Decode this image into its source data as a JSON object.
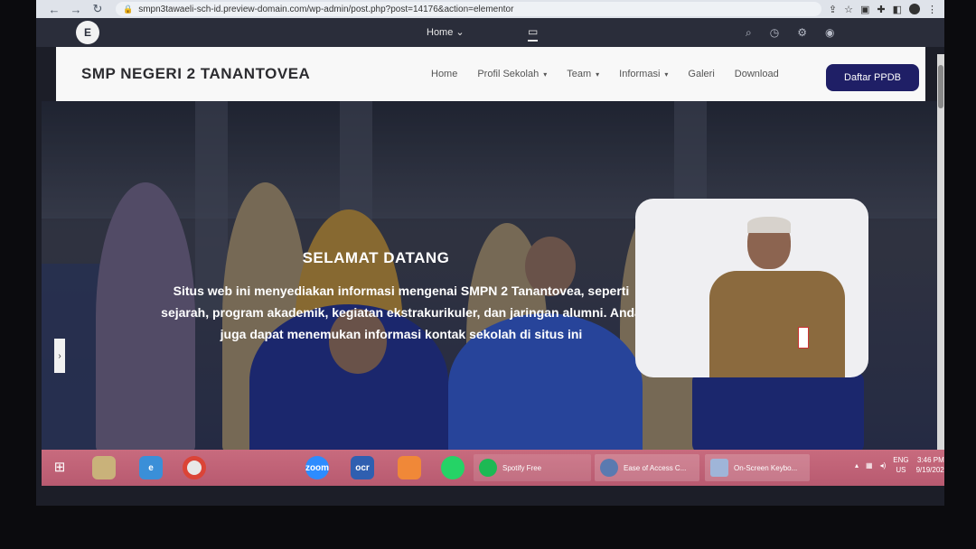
{
  "browser": {
    "url": "smpn3tawaeli-sch-id.preview-domain.com/wp-admin/post.php?post=14176&action=elementor",
    "nav": {
      "back": "←",
      "forward": "→",
      "reload": "↻"
    },
    "toolbar_icons": [
      "share-icon",
      "star-icon",
      "extension-icon",
      "puzzle-icon",
      "sidebar-icon",
      "profile-icon",
      "menu-icon"
    ]
  },
  "editor": {
    "logo": "E",
    "page_selector": "Home",
    "device_icon": "desktop-icon",
    "tool_icons": [
      "search-icon",
      "history-icon",
      "notifications-icon",
      "preview-icon"
    ]
  },
  "site": {
    "title": "SMP NEGERI 2 TANANTOVEA",
    "nav": [
      {
        "label": "Home",
        "dropdown": false
      },
      {
        "label": "Profil Sekolah",
        "dropdown": true
      },
      {
        "label": "Team",
        "dropdown": true
      },
      {
        "label": "Informasi",
        "dropdown": true
      },
      {
        "label": "Galeri",
        "dropdown": false
      },
      {
        "label": "Download",
        "dropdown": false
      }
    ],
    "cta": "Daftar PPDB"
  },
  "hero": {
    "heading": "SELAMAT DATANG",
    "text": "Situs web ini menyediakan informasi mengenai SMPN 2 Tanantovea, seperti sejarah, program akademik, kegiatan ekstrakurikuler, dan jaringan alumni. Anda juga dapat menemukan informasi kontak sekolah di situs ini",
    "side_toggle": "›"
  },
  "taskbar": {
    "start": "⊞",
    "apps": [
      {
        "name": "file-explorer",
        "label": ""
      },
      {
        "name": "internet-explorer",
        "label": ""
      },
      {
        "name": "chrome",
        "label": ""
      },
      {
        "name": "zoom",
        "label": "zoom"
      },
      {
        "name": "ocr",
        "label": "ocr"
      },
      {
        "name": "xampp",
        "label": ""
      },
      {
        "name": "whatsapp",
        "label": ""
      },
      {
        "name": "spotify",
        "label": "Spotify Free"
      }
    ],
    "windows": [
      {
        "label": "Ease of Access C..."
      },
      {
        "label": "On-Screen Keybo..."
      }
    ],
    "tray": {
      "lang": "ENG",
      "region": "US",
      "time": "3:46 PM",
      "date": "9/19/202"
    }
  },
  "colors": {
    "cta_bg": "#1f1f66",
    "taskbar_bg": "#c86b7e",
    "editor_bar": "#2a2d3a"
  }
}
